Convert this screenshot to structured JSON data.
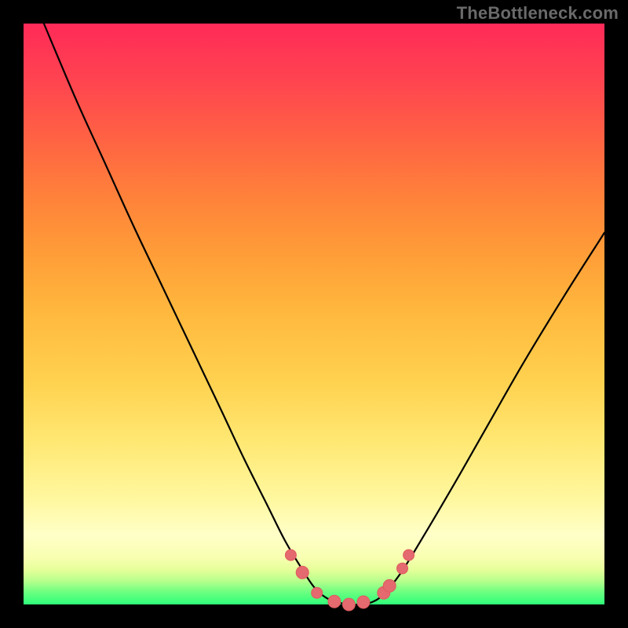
{
  "watermark": "TheBottleneck.com",
  "chart_data": {
    "type": "line",
    "title": "",
    "xlabel": "",
    "ylabel": "",
    "xlim": [
      0,
      1
    ],
    "ylim": [
      0,
      1
    ],
    "series": [
      {
        "name": "bottleneck-curve",
        "x": [
          0.035,
          0.09,
          0.14,
          0.19,
          0.24,
          0.29,
          0.34,
          0.38,
          0.42,
          0.45,
          0.48,
          0.5,
          0.52,
          0.54,
          0.56,
          0.58,
          0.6,
          0.62,
          0.65,
          0.69,
          0.74,
          0.8,
          0.86,
          0.93,
          1.0
        ],
        "y": [
          1.0,
          0.87,
          0.76,
          0.65,
          0.545,
          0.44,
          0.335,
          0.25,
          0.17,
          0.11,
          0.06,
          0.03,
          0.012,
          0.004,
          0.0,
          0.0,
          0.004,
          0.018,
          0.055,
          0.12,
          0.205,
          0.31,
          0.415,
          0.53,
          0.64
        ]
      }
    ],
    "markers": {
      "name": "highlight-points",
      "color": "#e46a6f",
      "stroke": "#e05a5f",
      "points": [
        {
          "x": 0.46,
          "y": 0.085,
          "r": 7
        },
        {
          "x": 0.48,
          "y": 0.055,
          "r": 8
        },
        {
          "x": 0.505,
          "y": 0.02,
          "r": 7
        },
        {
          "x": 0.535,
          "y": 0.005,
          "r": 8
        },
        {
          "x": 0.56,
          "y": 0.0,
          "r": 8
        },
        {
          "x": 0.585,
          "y": 0.004,
          "r": 8
        },
        {
          "x": 0.62,
          "y": 0.02,
          "r": 8
        },
        {
          "x": 0.63,
          "y": 0.032,
          "r": 8
        },
        {
          "x": 0.652,
          "y": 0.062,
          "r": 7
        },
        {
          "x": 0.663,
          "y": 0.085,
          "r": 7
        }
      ]
    }
  }
}
